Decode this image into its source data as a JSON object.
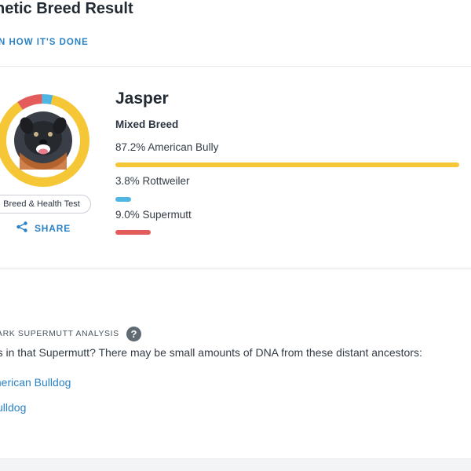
{
  "page": {
    "title": "netic Breed Result",
    "learn_link": "N HOW IT'S DONE"
  },
  "dog": {
    "name": "Jasper",
    "mix": "Mixed Breed",
    "test_badge": "Breed & Health Test",
    "share_label": "SHARE",
    "photo_icon": "dog-photo"
  },
  "breeds": [
    {
      "label": "87.2% American Bully",
      "percent": 87.2,
      "color": "#f5c736"
    },
    {
      "label": "3.8% Rottweiler",
      "percent": 3.8,
      "color": "#4fb6e3"
    },
    {
      "label": "9.0% Supermutt",
      "percent": 9.0,
      "color": "#e35b5b"
    }
  ],
  "supermutt": {
    "title": "ARK SUPERMUTT ANALYSIS",
    "help_icon": "?",
    "text": "t's in that Supermutt? There may be small amounts of DNA from these distant ancestors:",
    "ancestors": [
      {
        "label": "merican Bulldog"
      },
      {
        "label": "ulldog"
      }
    ]
  },
  "colors": {
    "link": "#2a82c6",
    "card_border": "#e9ecef",
    "donut_track": "#f5c736"
  }
}
